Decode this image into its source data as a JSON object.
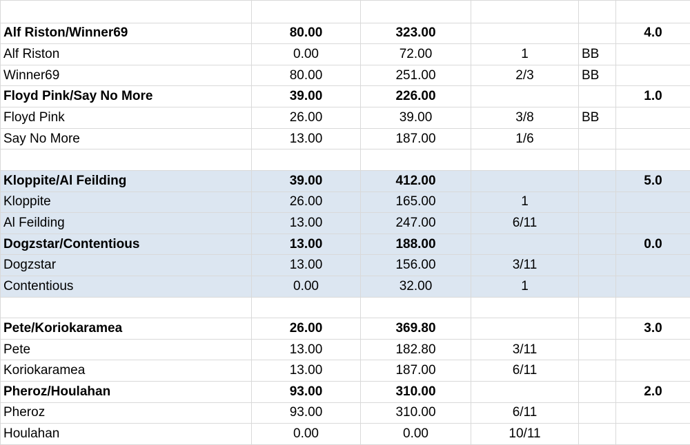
{
  "rows": [
    {
      "cells": [
        "",
        "",
        "",
        "",
        "",
        ""
      ],
      "bold": false,
      "shaded": false
    },
    {
      "cells": [
        "Alf Riston/Winner69",
        "80.00",
        "323.00",
        "",
        "",
        "4.0"
      ],
      "bold": true,
      "shaded": false
    },
    {
      "cells": [
        "Alf Riston",
        "0.00",
        "72.00",
        "1",
        "BB",
        ""
      ],
      "bold": false,
      "shaded": false
    },
    {
      "cells": [
        "Winner69",
        "80.00",
        "251.00",
        "2/3",
        "BB",
        ""
      ],
      "bold": false,
      "shaded": false
    },
    {
      "cells": [
        "Floyd Pink/Say No More",
        "39.00",
        "226.00",
        "",
        "",
        "1.0"
      ],
      "bold": true,
      "shaded": false
    },
    {
      "cells": [
        "Floyd Pink",
        "26.00",
        "39.00",
        "3/8",
        "BB",
        ""
      ],
      "bold": false,
      "shaded": false
    },
    {
      "cells": [
        "Say No More",
        "13.00",
        "187.00",
        "1/6",
        "",
        ""
      ],
      "bold": false,
      "shaded": false
    },
    {
      "cells": [
        "",
        "",
        "",
        "",
        "",
        ""
      ],
      "bold": false,
      "shaded": false
    },
    {
      "cells": [
        "Kloppite/Al Feilding",
        "39.00",
        "412.00",
        "",
        "",
        "5.0"
      ],
      "bold": true,
      "shaded": true
    },
    {
      "cells": [
        "Kloppite",
        "26.00",
        "165.00",
        "1",
        "",
        ""
      ],
      "bold": false,
      "shaded": true
    },
    {
      "cells": [
        "Al Feilding",
        "13.00",
        "247.00",
        "6/11",
        "",
        ""
      ],
      "bold": false,
      "shaded": true
    },
    {
      "cells": [
        "Dogzstar/Contentious",
        "13.00",
        "188.00",
        "",
        "",
        "0.0"
      ],
      "bold": true,
      "shaded": true
    },
    {
      "cells": [
        "Dogzstar",
        "13.00",
        "156.00",
        "3/11",
        "",
        ""
      ],
      "bold": false,
      "shaded": true
    },
    {
      "cells": [
        "Contentious",
        "0.00",
        "32.00",
        "1",
        "",
        ""
      ],
      "bold": false,
      "shaded": true
    },
    {
      "cells": [
        "",
        "",
        "",
        "",
        "",
        ""
      ],
      "bold": false,
      "shaded": false
    },
    {
      "cells": [
        "Pete/Koriokaramea",
        "26.00",
        "369.80",
        "",
        "",
        "3.0"
      ],
      "bold": true,
      "shaded": false
    },
    {
      "cells": [
        "Pete",
        "13.00",
        "182.80",
        "3/11",
        "",
        ""
      ],
      "bold": false,
      "shaded": false
    },
    {
      "cells": [
        "Koriokaramea",
        "13.00",
        "187.00",
        "6/11",
        "",
        ""
      ],
      "bold": false,
      "shaded": false
    },
    {
      "cells": [
        "Pheroz/Houlahan",
        "93.00",
        "310.00",
        "",
        "",
        "2.0"
      ],
      "bold": true,
      "shaded": false
    },
    {
      "cells": [
        "Pheroz",
        "93.00",
        "310.00",
        "6/11",
        "",
        ""
      ],
      "bold": false,
      "shaded": false
    },
    {
      "cells": [
        "Houlahan",
        "0.00",
        "0.00",
        "10/11",
        "",
        ""
      ],
      "bold": false,
      "shaded": false
    }
  ],
  "colors": {
    "shade": "#dce6f1",
    "grid": "#d9d9d9"
  }
}
